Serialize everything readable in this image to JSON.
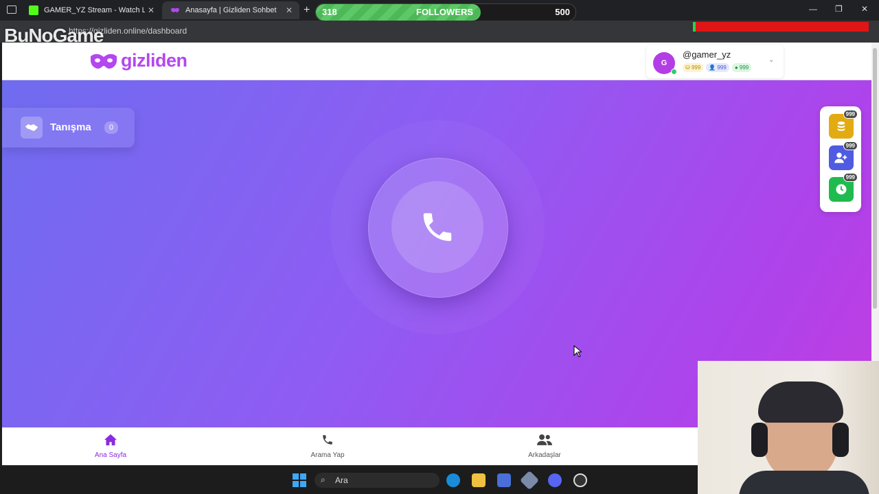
{
  "browser": {
    "tabs": [
      {
        "title": "GAMER_YZ Stream - Watch Live o",
        "active": false,
        "icon": "kick-icon",
        "color": "#53fc18"
      },
      {
        "title": "Anasayfa | Gizliden Sohbet",
        "active": true,
        "icon": "mask-icon",
        "color": "#b447ef"
      }
    ],
    "url": "https://gizliden.online/dashboard"
  },
  "overlay": {
    "followers_current": "318",
    "followers_label": "FOLLOWERS",
    "followers_goal": "500",
    "followers_progress": 0.636,
    "brand": "BuNoGame"
  },
  "app": {
    "logo_text": "gizliden",
    "brand_color": "#b447ef",
    "user": {
      "avatar_letter": "G",
      "username": "@gamer_yz",
      "stats": [
        "999",
        "999",
        "999"
      ]
    },
    "tanisma": {
      "label": "Tanışma",
      "count": "0"
    },
    "call_button_icon": "phone-icon",
    "side_buttons": [
      {
        "icon": "coins-icon",
        "badge": "999",
        "color": "#e3ab12"
      },
      {
        "icon": "add-user-icon",
        "badge": "999",
        "color": "#4f5be0"
      },
      {
        "icon": "clock-icon",
        "badge": "999",
        "color": "#1fbb4e"
      }
    ],
    "nav": [
      {
        "label": "Ana Sayfa",
        "icon": "home-icon",
        "active": true
      },
      {
        "label": "Arama Yap",
        "icon": "phone-icon",
        "active": false
      },
      {
        "label": "Arkadaşlar",
        "icon": "users-icon",
        "active": false
      }
    ],
    "active_color": "#8a2be2",
    "inactive_color": "#555555"
  },
  "taskbar": {
    "search_label": "Ara"
  }
}
